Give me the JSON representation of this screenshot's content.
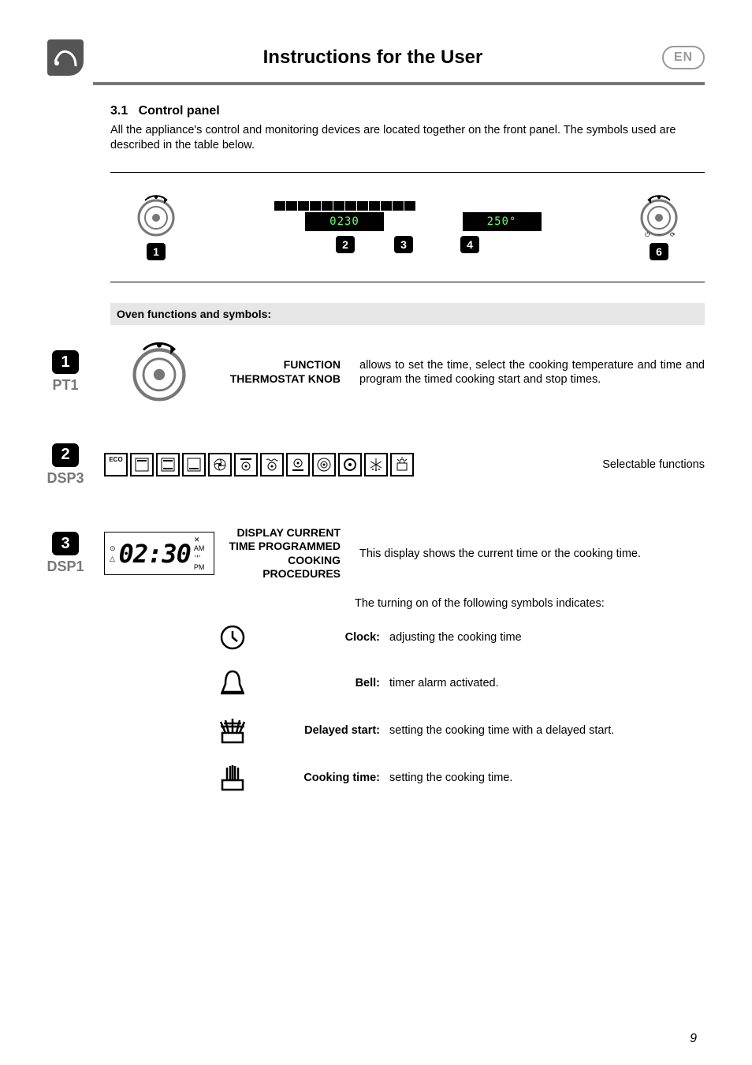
{
  "header": {
    "title": "Instructions for the User",
    "lang_badge": "EN"
  },
  "section": {
    "number": "3.1",
    "title": "Control panel",
    "intro": "All the appliance's control and monitoring devices are located together on the front panel. The symbols used are described in the table below."
  },
  "panel_figure": {
    "callouts": [
      "1",
      "2",
      "3",
      "4",
      "6"
    ],
    "disp_left": "0230",
    "disp_right": "250°"
  },
  "subheading": "Oven functions and symbols:",
  "row1": {
    "callout": "1",
    "side_label": "PT1",
    "term": "FUNCTION THERMOSTAT KNOB",
    "desc": "allows to set the time, select the cooking temperature and time and program the timed cooking start and stop times."
  },
  "row2": {
    "callout": "2",
    "side_label": "DSP3",
    "icons": [
      "eco",
      "upper",
      "both",
      "lower",
      "fan",
      "fan-upper",
      "fan-center",
      "fan-lower",
      "fan-ring",
      "ring",
      "defrost",
      "pyrolytic"
    ],
    "desc": "Selectable functions"
  },
  "row3": {
    "callout": "3",
    "side_label": "DSP1",
    "time": "02:30",
    "am": "AM",
    "pm": "PM",
    "term": "DISPLAY CURRENT TIME PROGRAMMED COOKING PROCEDURES",
    "desc": "This display shows the current time or the cooking time."
  },
  "symbols": {
    "intro": "The turning on of the following symbols indicates:",
    "items": [
      {
        "name": "clock",
        "term": "Clock:",
        "desc": "adjusting the cooking time"
      },
      {
        "name": "bell",
        "term": "Bell:",
        "desc": "timer alarm activated."
      },
      {
        "name": "delayed",
        "term": "Delayed start:",
        "desc": "setting the cooking time with a delayed start."
      },
      {
        "name": "cooking-time",
        "term": "Cooking time:",
        "desc": "setting the cooking time."
      }
    ]
  },
  "page_number": "9"
}
